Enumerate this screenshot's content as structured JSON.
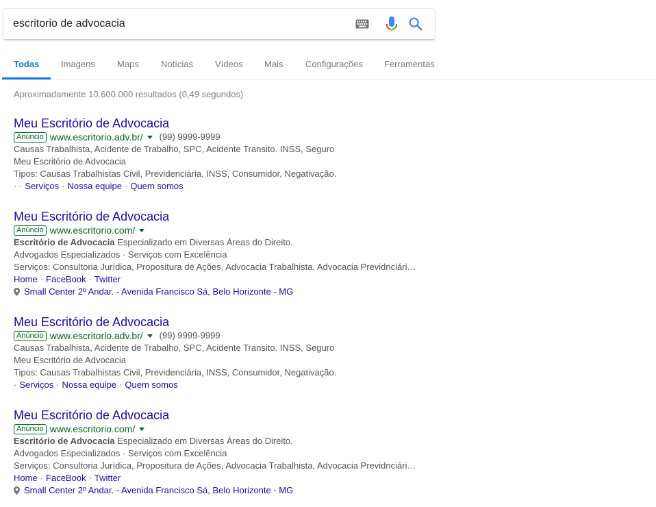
{
  "search": {
    "query": "escritorio de advocacia"
  },
  "tabs": [
    {
      "label": "Todas"
    },
    {
      "label": "Imagens"
    },
    {
      "label": "Maps"
    },
    {
      "label": "Notícias"
    },
    {
      "label": "Vídeos"
    },
    {
      "label": "Mais"
    },
    {
      "label": "Configurações"
    },
    {
      "label": "Ferramentas"
    }
  ],
  "result_stats": "Aproximadamente 10.600.000 resultados (0,49 segundos)",
  "ad_badge": "Anúncio",
  "ads": [
    {
      "title": "Meu Escritório de Advocacia",
      "url": "www.escritorio.adv.br/",
      "phone": "(99) 9999-9999",
      "lines": [
        "Causas Trabalhista, Acidente de Trabalho, SPC, Acidente Transito. INSS, Seguro",
        "Meu Escritório de Advocacia",
        "Tipos: Causas Trabalhistas Civil, Previdenciária, INSS, Consumidor, Negativação."
      ],
      "links": [
        "Serviços",
        "Nossa equipe",
        "Quem somos"
      ]
    },
    {
      "title": "Meu Escritório de Advocacia",
      "url": "www.escritorio.com/",
      "desc_bold": "Escritório de Advocacia",
      "desc_rest": " Especializado em Diversas Áreas do Direito.",
      "lines": [
        "Advogados Especializados · Serviços com Excelência",
        "Serviços: Consultoria Jurídica, Propositura de Ações, Advocacia Trabalhista, Advocacia Previdnciári…"
      ],
      "links": [
        "Home",
        "FaceBook",
        "Twitter"
      ],
      "address": "Small Center 2º Andar. - Avenida Francisco Sá, Belo Horizonte - MG"
    },
    {
      "title": "Meu Escritório de Advocacia",
      "url": "www.escritorio.adv.br/",
      "phone": "(99) 9999-9999",
      "lines": [
        "Causas Trabalhista, Acidente de Trabalho, SPC, Acidente Transito. INSS, Seguro",
        "Meu Escritório de Advocacia",
        "Tipos: Causas Trabalhistas Civil, Previdenciária, INSS, Consumidor, Negativação."
      ],
      "links": [
        "Serviços",
        "Nossa equipe",
        "Quem somos"
      ]
    },
    {
      "title": "Meu Escritório de Advocacia",
      "url": "www.escritorio.com/",
      "desc_bold": "Escritório de Advocacia",
      "desc_rest": " Especializado em Diversas Áreas do Direito.",
      "lines": [
        "Advogados Especializados · Serviços com Excelência",
        "Serviços: Consultoria Jurídica, Propositura de Ações, Advocacia Trabalhista, Advocacia Previdnciári…"
      ],
      "links": [
        "Home",
        "FaceBook",
        "Twitter"
      ],
      "address": "Small Center 2º Andar. - Avenida Francisco Sá, Belo Horizonte - MG"
    }
  ],
  "colors": {
    "link": "#1a0dab",
    "url_green": "#006621",
    "active_tab": "#1a73e8",
    "snippet": "#545454"
  }
}
